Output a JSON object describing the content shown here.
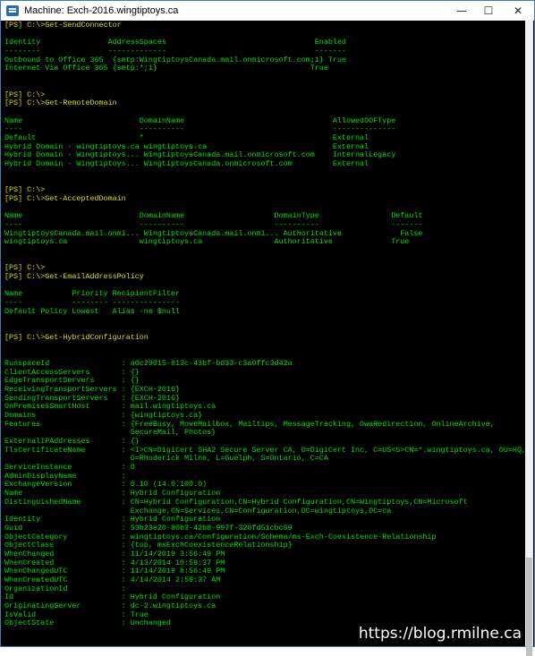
{
  "window": {
    "title": "Machine: Exch-2016.wingtiptoys.ca",
    "minimize_glyph": "—",
    "maximize_glyph": "☐",
    "close_glyph": "✕"
  },
  "console": {
    "lines": [
      {
        "text": "[PS] C:\\>Get-SendConnector",
        "prompt": true
      },
      {
        "text": "",
        "prompt": false
      },
      {
        "text": "Identity               AddressSpaces                                 Enabled",
        "prompt": false
      },
      {
        "text": "--------               -------------                                 -------",
        "prompt": false
      },
      {
        "text": "Outbound to Office 365  {smtp:WingtiptoysCanada.mail.onmicrosoft.com;1} True",
        "prompt": false
      },
      {
        "text": "Internet Via Office 365 {smtp:*;1}                                  True",
        "prompt": false
      },
      {
        "text": "",
        "prompt": false
      },
      {
        "text": "",
        "prompt": false
      },
      {
        "text": "[PS] C:\\>",
        "prompt": true
      },
      {
        "text": "[PS] C:\\>Get-RemoteDomain",
        "prompt": true
      },
      {
        "text": "",
        "prompt": false
      },
      {
        "text": "Name                          DomainName                                 AllowedOOFType",
        "prompt": false
      },
      {
        "text": "----                          ----------                                 --------------",
        "prompt": false
      },
      {
        "text": "Default                       *                                          External",
        "prompt": false
      },
      {
        "text": "Hybrid Domain - wingtiptoys.ca wingtiptoys.ca                            External",
        "prompt": false
      },
      {
        "text": "Hybrid Domain - Wingtiptoys... WingtiptoysCanada.mail.onmicrosoft.com    InternalLegacy",
        "prompt": false
      },
      {
        "text": "Hybrid Domain - Wingtiptoys... WingtiptoysCanada.onmicrosoft.com         External",
        "prompt": false
      },
      {
        "text": "",
        "prompt": false
      },
      {
        "text": "",
        "prompt": false
      },
      {
        "text": "[PS] C:\\>",
        "prompt": true
      },
      {
        "text": "[PS] C:\\>Get-AcceptedDomain",
        "prompt": true
      },
      {
        "text": "",
        "prompt": false
      },
      {
        "text": "Name                          DomainName                    DomainType                Default",
        "prompt": false
      },
      {
        "text": "----                          ----------                    ----------                -------",
        "prompt": false
      },
      {
        "text": "WingtiptoysCanada.mail.onmi... WingtiptoysCanada.mail.onmi... Authoritative             False",
        "prompt": false
      },
      {
        "text": "wingtiptoys.ca                wingtiptoys.ca                Authoritative             True",
        "prompt": false
      },
      {
        "text": "",
        "prompt": false
      },
      {
        "text": "",
        "prompt": false
      },
      {
        "text": "[PS] C:\\>",
        "prompt": true
      },
      {
        "text": "[PS] C:\\>Get-EmailAddressPolicy",
        "prompt": true
      },
      {
        "text": "",
        "prompt": false
      },
      {
        "text": "Name           Priority RecipientFilter",
        "prompt": false
      },
      {
        "text": "----           -------- ---------------",
        "prompt": false
      },
      {
        "text": "Default Policy Lowest   Alias -ne $null",
        "prompt": false
      },
      {
        "text": "",
        "prompt": false
      },
      {
        "text": "",
        "prompt": false
      },
      {
        "text": "[PS] C:\\>Get-HybridConfiguration",
        "prompt": true
      },
      {
        "text": "",
        "prompt": false
      },
      {
        "text": "",
        "prompt": false
      },
      {
        "text": "RunspaceId                : a0c29015-813c-43bf-bd33-c3a0ffc3d42a",
        "prompt": false
      },
      {
        "text": "ClientAccessServers       : {}",
        "prompt": false
      },
      {
        "text": "EdgeTransportServers      : {}",
        "prompt": false
      },
      {
        "text": "ReceivingTransportServers : {EXCH-2016}",
        "prompt": false
      },
      {
        "text": "SendingTransportServers   : {EXCH-2016}",
        "prompt": false
      },
      {
        "text": "OnPremisesSmartHost       : mail.wingtiptoys.ca",
        "prompt": false
      },
      {
        "text": "Domains                   : {wingtiptoys.ca}",
        "prompt": false
      },
      {
        "text": "Features                  : {FreeBusy, MoveMailbox, Mailtips, MessageTracking, OwaRedirection, OnlineArchive,",
        "prompt": false
      },
      {
        "text": "                            SecureMail, Photos}",
        "prompt": false
      },
      {
        "text": "ExternalIPAddresses       : {}",
        "prompt": false
      },
      {
        "text": "TlsCertificateName        : <I>CN=DigiCert SHA2 Secure Server CA, O=DigiCert Inc, C=US<S>CN=*.wingtiptoys.ca, OU=HQ,",
        "prompt": false
      },
      {
        "text": "                            O=Rhoderick Milne, L=Guelph, S=Ontario, C=CA",
        "prompt": false
      },
      {
        "text": "ServiceInstance           : 0",
        "prompt": false
      },
      {
        "text": "AdminDisplayName          :",
        "prompt": false
      },
      {
        "text": "ExchangeVersion           : 0.10 (14.0.100.0)",
        "prompt": false
      },
      {
        "text": "Name                      : Hybrid Configuration",
        "prompt": false
      },
      {
        "text": "DistinguishedName         : CN=Hybrid Configuration,CN=Hybrid Configuration,CN=Wingtiptoys,CN=Microsoft",
        "prompt": false
      },
      {
        "text": "                            Exchange,CN=Services,CN=Configuration,DC=wingtiptoys,DC=ca",
        "prompt": false
      },
      {
        "text": "Identity                  : Hybrid Configuration",
        "prompt": false
      },
      {
        "text": "Guid                      : 53b23e20-80b3-42b8-997f-320fd51cbc69",
        "prompt": false
      },
      {
        "text": "ObjectCategory            : wingtiptoys.ca/Configuration/Schema/ms-Exch-Coexistence-Relationship",
        "prompt": false
      },
      {
        "text": "ObjectClass               : {top, msExchCoexistenceRelationship}",
        "prompt": false
      },
      {
        "text": "WhenChanged               : 11/14/2019 3:56:49 PM",
        "prompt": false
      },
      {
        "text": "WhenCreated               : 4/13/2014 10:59:37 PM",
        "prompt": false
      },
      {
        "text": "WhenChangedUTC            : 11/14/2019 8:56:49 PM",
        "prompt": false
      },
      {
        "text": "WhenCreatedUTC            : 4/14/2014 2:59:37 AM",
        "prompt": false
      },
      {
        "text": "OrganizationId            :",
        "prompt": false
      },
      {
        "text": "Id                        : Hybrid Configuration",
        "prompt": false
      },
      {
        "text": "OriginatingServer         : dc-2.wingtiptoys.ca",
        "prompt": false
      },
      {
        "text": "IsValid                   : True",
        "prompt": false
      },
      {
        "text": "ObjectState               : Unchanged",
        "prompt": false
      }
    ]
  },
  "watermark": "https://blog.rmilne.ca"
}
